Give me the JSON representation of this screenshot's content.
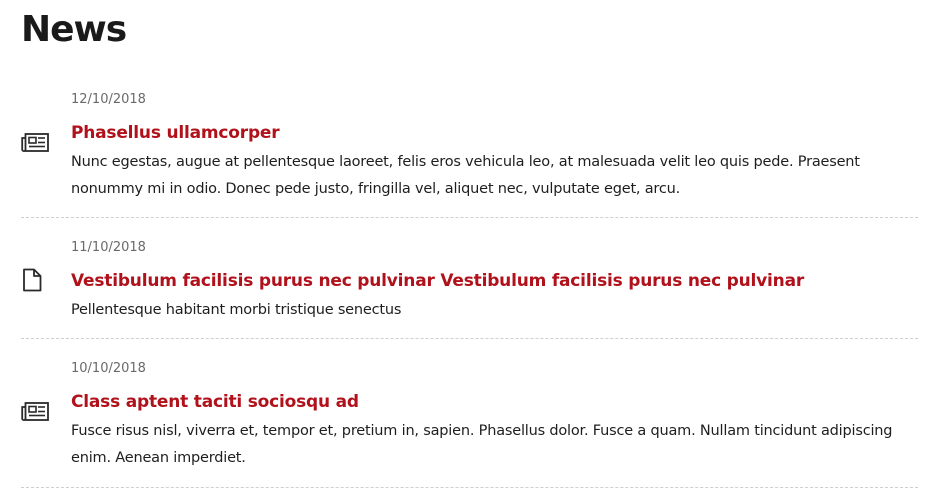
{
  "page": {
    "title": "News"
  },
  "colors": {
    "title_link": "#b0111b",
    "date": "#6a6a6a",
    "body": "#1e1e1e",
    "divider": "#cfcfcf"
  },
  "news": {
    "items": [
      {
        "date": "12/10/2018",
        "title": "Phasellus ullamcorper",
        "text": "Nunc egestas, augue at pellentesque laoreet, felis eros vehicula leo, at malesuada velit leo quis pede. Praesent nonummy mi in odio. Donec pede justo, fringilla vel, aliquet nec, vulputate eget, arcu.",
        "icon": "newspaper-icon"
      },
      {
        "date": "11/10/2018",
        "title": "Vestibulum facilisis purus nec pulvinar Vestibulum facilisis purus nec pulvinar",
        "text": "Pellentesque habitant morbi tristique senectus",
        "icon": "document-icon"
      },
      {
        "date": "10/10/2018",
        "title": "Class aptent taciti sociosqu ad",
        "text": "Fusce risus nisl, viverra et, tempor et, pretium in, sapien. Phasellus dolor. Fusce a quam. Nullam tincidunt adipiscing enim. Aenean imperdiet.",
        "icon": "newspaper-icon"
      }
    ]
  }
}
